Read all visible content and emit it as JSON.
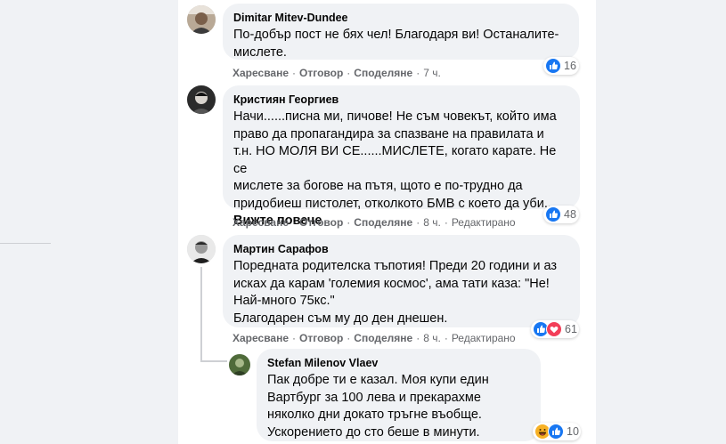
{
  "actions": {
    "like": "Харесване",
    "reply": "Отговор",
    "share": "Споделяне",
    "edited": "Редактирано"
  },
  "comments": [
    {
      "author": "Dimitar Mitev-Dundee",
      "lines": [
        "По-добър пост не бях чел! Благодаря ви! Останалите-",
        "мислете."
      ],
      "time": "7 ч.",
      "reactions": [
        "like"
      ],
      "reaction_count": "16"
    },
    {
      "author": "Кристиян Георгиев",
      "lines": [
        "Начи......писна ми, пичове! Не съм човекът, който има",
        "право да пропагандира за спазване на правилата и",
        "т.н. НО МОЛЯ ВИ СЕ......МИСЛЕТЕ, когато карате. Не се",
        "мислете за богове на пътя, щото е по-трудно да",
        "придобиеш пистолет, отколкото БМВ с което да уби..."
      ],
      "see_more": "Вижте повече",
      "time": "8 ч.",
      "edited": true,
      "reactions": [
        "like"
      ],
      "reaction_count": "48"
    },
    {
      "author": "Мартин Сарафов",
      "lines": [
        "Поредната родителска тъпотия! Преди 20 години и аз",
        "исках да карам 'големия космос', ама тати каза: \"Не!",
        "Най-много 75кс.\"",
        "Благодарен съм му до ден днешен."
      ],
      "time": "8 ч.",
      "edited": true,
      "reactions": [
        "like",
        "love"
      ],
      "reaction_count": "61"
    },
    {
      "author": "Stefan Milenov Vlaev",
      "lines": [
        "Пак добре ти е казал. Моя купи един",
        "Вартбург за 100 лева и прекарахме",
        "няколко дни докато тръгне въобще.",
        "Ускорението до сто беше в минути."
      ],
      "reactions": [
        "haha",
        "like"
      ],
      "reaction_count": "10"
    }
  ],
  "colors": {
    "like_blue": "#1877f2",
    "love_red": "#f33e58",
    "haha_yellow": "#f7b125",
    "muted_text": "#65676b",
    "bubble_bg": "#f0f2f5"
  }
}
